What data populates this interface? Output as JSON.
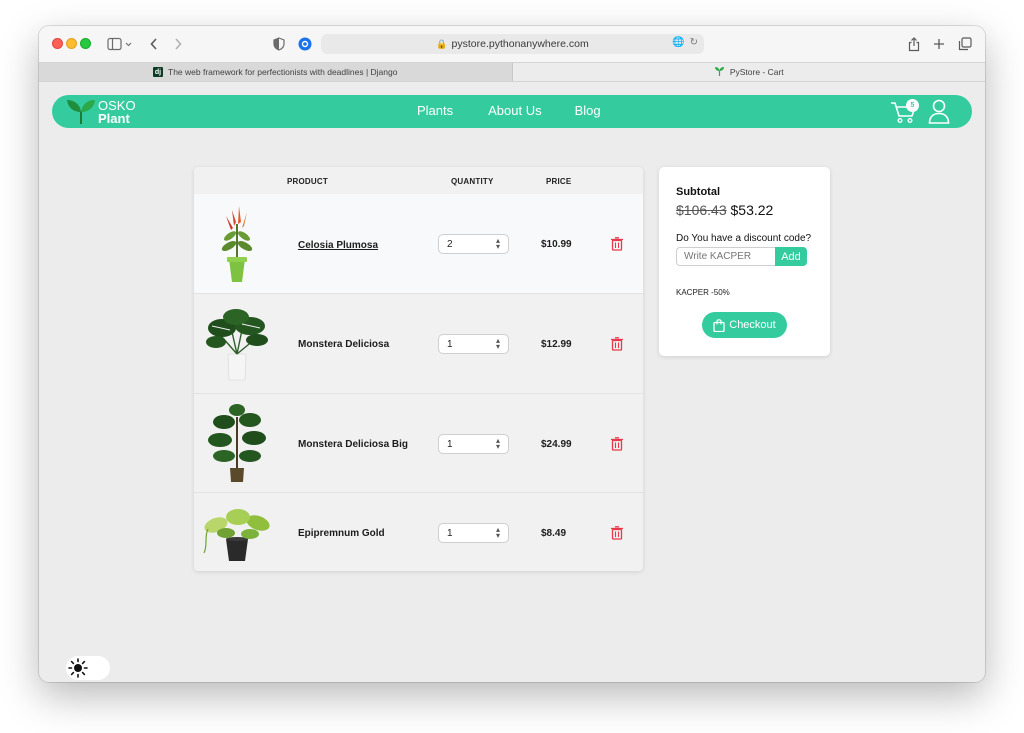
{
  "browser": {
    "url": "pystore.pythonanywhere.com",
    "tabs": [
      {
        "title": "The web framework for perfectionists with deadlines | Django",
        "favicon": "dj",
        "active": false
      },
      {
        "title": "PyStore - Cart",
        "favicon": "sprout-icon",
        "active": true
      }
    ]
  },
  "nav": {
    "logo_top": "OSKO",
    "logo_bottom": "Plant",
    "links": [
      "Plants",
      "About Us",
      "Blog"
    ],
    "cart_count": "5"
  },
  "table": {
    "headers": {
      "product": "PRODUCT",
      "quantity": "QUANTITY",
      "price": "PRICE"
    },
    "rows": [
      {
        "name": "Celosia Plumosa",
        "quantity": "2",
        "price": "$10.99"
      },
      {
        "name": "Monstera Deliciosa",
        "quantity": "1",
        "price": "$12.99"
      },
      {
        "name": "Monstera Deliciosa Big",
        "quantity": "1",
        "price": "$24.99"
      },
      {
        "name": "Epipremnum Gold",
        "quantity": "1",
        "price": "$8.49"
      }
    ]
  },
  "summary": {
    "title": "Subtotal",
    "old_price": "$106.43",
    "new_price": "$53.22",
    "discount_question": "Do You have a discount code?",
    "discount_placeholder": "Write KACPER",
    "add_label": "Add",
    "applied": "KACPER -50%",
    "checkout_label": "Checkout"
  },
  "colors": {
    "accent": "#34cc9f",
    "danger": "#e8394a"
  }
}
